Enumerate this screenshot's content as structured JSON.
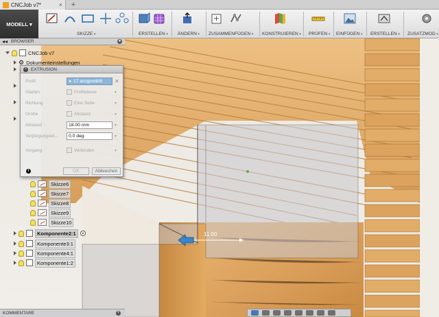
{
  "window": {
    "tab_title": "CNCJob v7*",
    "tab_close": "×",
    "tab_add": "+"
  },
  "ribbon": {
    "workspace": "MODELL",
    "groups": [
      "SKIZZE",
      "ERSTELLEN",
      "ÄNDERN",
      "ZUSAMMENFÜGEN",
      "KONSTRUIEREN",
      "PRÜFEN",
      "EINFÜGEN",
      "ERSTELLEN",
      "ZUSATZMOD"
    ]
  },
  "browser": {
    "header": "BROWSER",
    "root": "CNCJob v7",
    "doc_settings": "Dokumenteinstellungen",
    "sketches": [
      "Skizze6",
      "Skizze7",
      "Skizze8",
      "Skizze9",
      "Skizze10"
    ],
    "components": [
      "Komponente2:1",
      "Komponente3:1",
      "Komponente4:1",
      "Komponente1:2"
    ]
  },
  "dialog": {
    "title": "EXTRUSION",
    "rows": {
      "profil": {
        "label": "Profil",
        "value": "17 ausgewählt"
      },
      "starten": {
        "label": "Starten",
        "value": "Profilebene"
      },
      "richtung": {
        "label": "Richtung",
        "value": "Eine Seite"
      },
      "groesse": {
        "label": "Größe",
        "value": "Abstand"
      },
      "abstand": {
        "label": "Abstand",
        "value": "18.00 mm"
      },
      "verjuengung": {
        "label": "Verjüngungswi...",
        "value": "0.0 deg"
      },
      "vorgang": {
        "label": "Vorgang",
        "value": "Verbinden"
      }
    },
    "ok": "OK",
    "cancel": "Abbrechen",
    "info": "i"
  },
  "viewport": {
    "dimension_label": "11.00"
  },
  "bottom": {
    "comments": "KOMMENTARE",
    "comments_add": "+"
  },
  "colors": {
    "wood_light": "#e9b878",
    "wood_mid": "#d79a52",
    "wood_dark": "#b47530",
    "selection_overlay": "#c9c7cc",
    "accent_blue": "#3a86c8",
    "ribbon_dark": "#363636"
  }
}
